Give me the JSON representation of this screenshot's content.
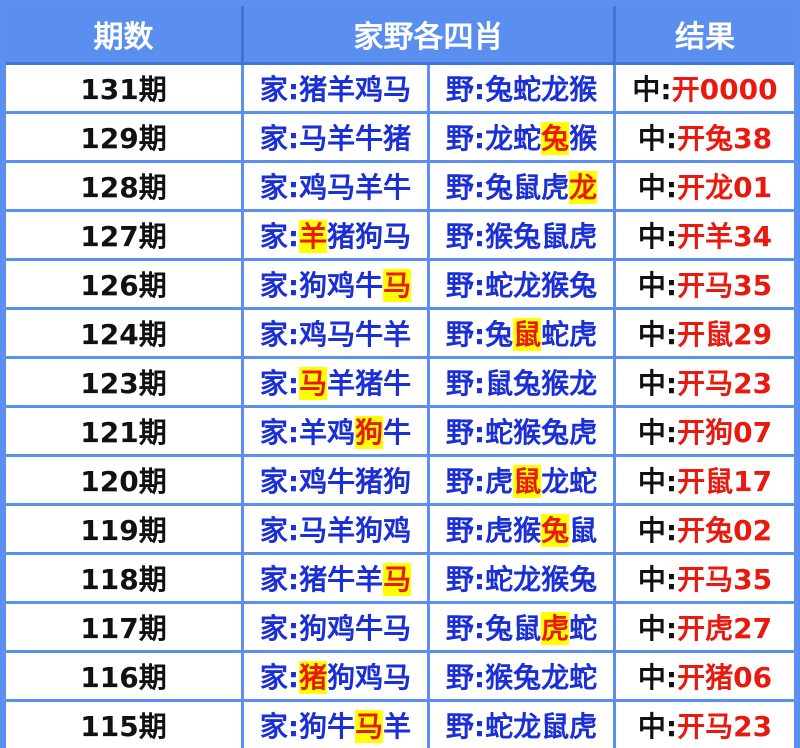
{
  "headers": [
    "期数",
    "家野各四肖",
    "结果"
  ],
  "rows": [
    {
      "period": "131期",
      "home_prefix": "家:",
      "home": [
        "猪",
        "羊",
        "鸡",
        "马"
      ],
      "home_hit": -1,
      "wild_prefix": "野:",
      "wild": [
        "兔",
        "蛇",
        "龙",
        "猴"
      ],
      "wild_hit": -1,
      "result_prefix": "中:",
      "result": "开0000"
    },
    {
      "period": "129期",
      "home_prefix": "家:",
      "home": [
        "马",
        "羊",
        "牛",
        "猪"
      ],
      "home_hit": -1,
      "wild_prefix": "野:",
      "wild": [
        "龙",
        "蛇",
        "兔",
        "猴"
      ],
      "wild_hit": 2,
      "result_prefix": "中:",
      "result": "开兔38"
    },
    {
      "period": "128期",
      "home_prefix": "家:",
      "home": [
        "鸡",
        "马",
        "羊",
        "牛"
      ],
      "home_hit": -1,
      "wild_prefix": "野:",
      "wild": [
        "兔",
        "鼠",
        "虎",
        "龙"
      ],
      "wild_hit": 3,
      "result_prefix": "中:",
      "result": "开龙01"
    },
    {
      "period": "127期",
      "home_prefix": "家:",
      "home": [
        "羊",
        "猪",
        "狗",
        "马"
      ],
      "home_hit": 0,
      "wild_prefix": "野:",
      "wild": [
        "猴",
        "兔",
        "鼠",
        "虎"
      ],
      "wild_hit": -1,
      "result_prefix": "中:",
      "result": "开羊34"
    },
    {
      "period": "126期",
      "home_prefix": "家:",
      "home": [
        "狗",
        "鸡",
        "牛",
        "马"
      ],
      "home_hit": 3,
      "wild_prefix": "野:",
      "wild": [
        "蛇",
        "龙",
        "猴",
        "兔"
      ],
      "wild_hit": -1,
      "result_prefix": "中:",
      "result": "开马35"
    },
    {
      "period": "124期",
      "home_prefix": "家:",
      "home": [
        "鸡",
        "马",
        "牛",
        "羊"
      ],
      "home_hit": -1,
      "wild_prefix": "野:",
      "wild": [
        "兔",
        "鼠",
        "蛇",
        "虎"
      ],
      "wild_hit": 1,
      "result_prefix": "中:",
      "result": "开鼠29"
    },
    {
      "period": "123期",
      "home_prefix": "家:",
      "home": [
        "马",
        "羊",
        "猪",
        "牛"
      ],
      "home_hit": 0,
      "wild_prefix": "野:",
      "wild": [
        "鼠",
        "兔",
        "猴",
        "龙"
      ],
      "wild_hit": -1,
      "result_prefix": "中:",
      "result": "开马23"
    },
    {
      "period": "121期",
      "home_prefix": "家:",
      "home": [
        "羊",
        "鸡",
        "狗",
        "牛"
      ],
      "home_hit": 2,
      "wild_prefix": "野:",
      "wild": [
        "蛇",
        "猴",
        "兔",
        "虎"
      ],
      "wild_hit": -1,
      "result_prefix": "中:",
      "result": "开狗07"
    },
    {
      "period": "120期",
      "home_prefix": "家:",
      "home": [
        "鸡",
        "牛",
        "猪",
        "狗"
      ],
      "home_hit": -1,
      "wild_prefix": "野:",
      "wild": [
        "虎",
        "鼠",
        "龙",
        "蛇"
      ],
      "wild_hit": 1,
      "result_prefix": "中:",
      "result": "开鼠17"
    },
    {
      "period": "119期",
      "home_prefix": "家:",
      "home": [
        "马",
        "羊",
        "狗",
        "鸡"
      ],
      "home_hit": -1,
      "wild_prefix": "野:",
      "wild": [
        "虎",
        "猴",
        "兔",
        "鼠"
      ],
      "wild_hit": 2,
      "result_prefix": "中:",
      "result": "开兔02"
    },
    {
      "period": "118期",
      "home_prefix": "家:",
      "home": [
        "猪",
        "牛",
        "羊",
        "马"
      ],
      "home_hit": 3,
      "wild_prefix": "野:",
      "wild": [
        "蛇",
        "龙",
        "猴",
        "兔"
      ],
      "wild_hit": -1,
      "result_prefix": "中:",
      "result": "开马35"
    },
    {
      "period": "117期",
      "home_prefix": "家:",
      "home": [
        "狗",
        "鸡",
        "牛",
        "马"
      ],
      "home_hit": -1,
      "wild_prefix": "野:",
      "wild": [
        "兔",
        "鼠",
        "虎",
        "蛇"
      ],
      "wild_hit": 2,
      "result_prefix": "中:",
      "result": "开虎27"
    },
    {
      "period": "116期",
      "home_prefix": "家:",
      "home": [
        "猪",
        "狗",
        "鸡",
        "马"
      ],
      "home_hit": 0,
      "wild_prefix": "野:",
      "wild": [
        "猴",
        "兔",
        "龙",
        "蛇"
      ],
      "wild_hit": -1,
      "result_prefix": "中:",
      "result": "开猪06"
    },
    {
      "period": "115期",
      "home_prefix": "家:",
      "home": [
        "狗",
        "牛",
        "马",
        "羊"
      ],
      "home_hit": 2,
      "wild_prefix": "野:",
      "wild": [
        "蛇",
        "龙",
        "鼠",
        "虎"
      ],
      "wild_hit": -1,
      "result_prefix": "中:",
      "result": "开马23"
    }
  ],
  "colors": {
    "frame": "#5b8ff0",
    "header_text": "#ffffff",
    "zodiac_text": "#1a2fd6",
    "result_value": "#e8190f",
    "highlight_bg": "#ffff00"
  }
}
